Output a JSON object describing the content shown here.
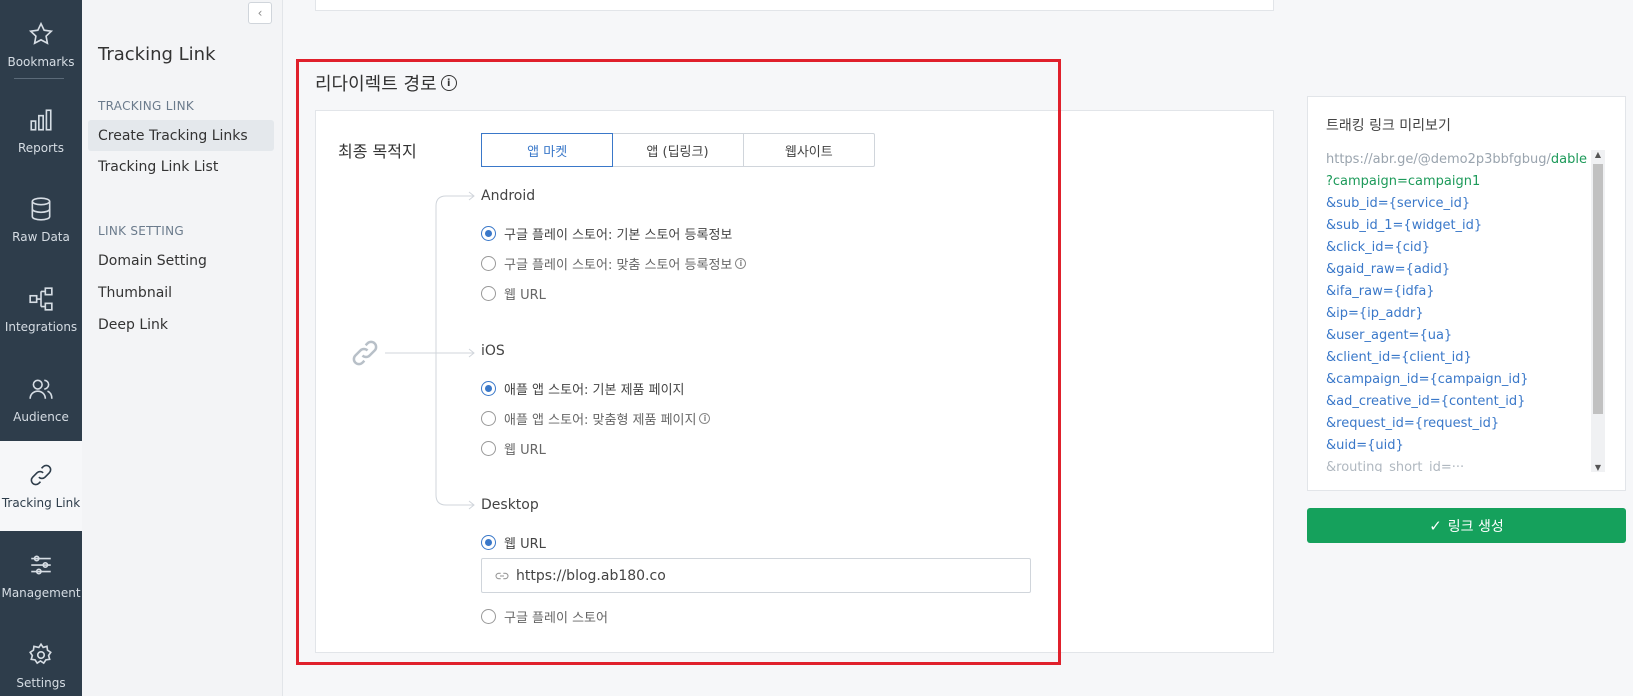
{
  "rail": {
    "items": [
      {
        "label": "Bookmarks",
        "icon": "star-icon"
      },
      {
        "label": "Reports",
        "icon": "bar-chart-icon"
      },
      {
        "label": "Raw Data",
        "icon": "database-icon"
      },
      {
        "label": "Integrations",
        "icon": "integrations-icon"
      },
      {
        "label": "Audience",
        "icon": "audience-icon"
      },
      {
        "label": "Tracking Link",
        "icon": "link-icon",
        "active": true
      },
      {
        "label": "Management",
        "icon": "sliders-icon"
      },
      {
        "label": "Settings",
        "icon": "gear-icon"
      }
    ]
  },
  "subnav": {
    "title": "Tracking Link",
    "sections": [
      {
        "label": "TRACKING LINK",
        "items": [
          "Create Tracking Links",
          "Tracking Link List"
        ]
      },
      {
        "label": "LINK SETTING",
        "items": [
          "Domain Setting",
          "Thumbnail",
          "Deep Link"
        ]
      }
    ]
  },
  "main": {
    "section_title": "리다이렉트 경로",
    "destination_label": "최종 목적지",
    "tabs": [
      "앱 마켓",
      "앱 (딥링크)",
      "웹사이트"
    ],
    "selected_tab": "앱 마켓",
    "android": {
      "label": "Android",
      "options": [
        "구글 플레이 스토어: 기본 스토어 등록정보",
        "구글 플레이 스토어: 맞춤 스토어 등록정보",
        "웹 URL"
      ]
    },
    "ios": {
      "label": "iOS",
      "options": [
        "애플 앱 스토어: 기본 제품 페이지",
        "애플 앱 스토어: 맞춤형 제품 페이지",
        "웹 URL"
      ]
    },
    "desktop": {
      "label": "Desktop",
      "options": [
        "웹 URL",
        "구글 플레이 스토어"
      ],
      "url_value": "https://blog.ab180.co"
    }
  },
  "preview": {
    "title": "트래킹 링크 미리보기",
    "base": "https://abr.ge/@demo2p3bbfgbug/",
    "path": "dable",
    "campaign": "?campaign=campaign1",
    "params": [
      "&sub_id={service_id}",
      "&sub_id_1={widget_id}",
      "&click_id={cid}",
      "&gaid_raw={adid}",
      "&ifa_raw={idfa}",
      "&ip={ip_addr}",
      "&user_agent={ua}",
      "&client_id={client_id}",
      "&campaign_id={campaign_id}",
      "&ad_creative_id={content_id}",
      "&request_id={request_id}",
      "&uid={uid}"
    ],
    "truncated": "&routing_short_id=···"
  },
  "generate_button": "링크 생성",
  "colors": {
    "rail_bg": "#2e3d4b",
    "accent_blue": "#3a78c9",
    "green": "#15a15c",
    "highlight_red": "#e0202c"
  }
}
